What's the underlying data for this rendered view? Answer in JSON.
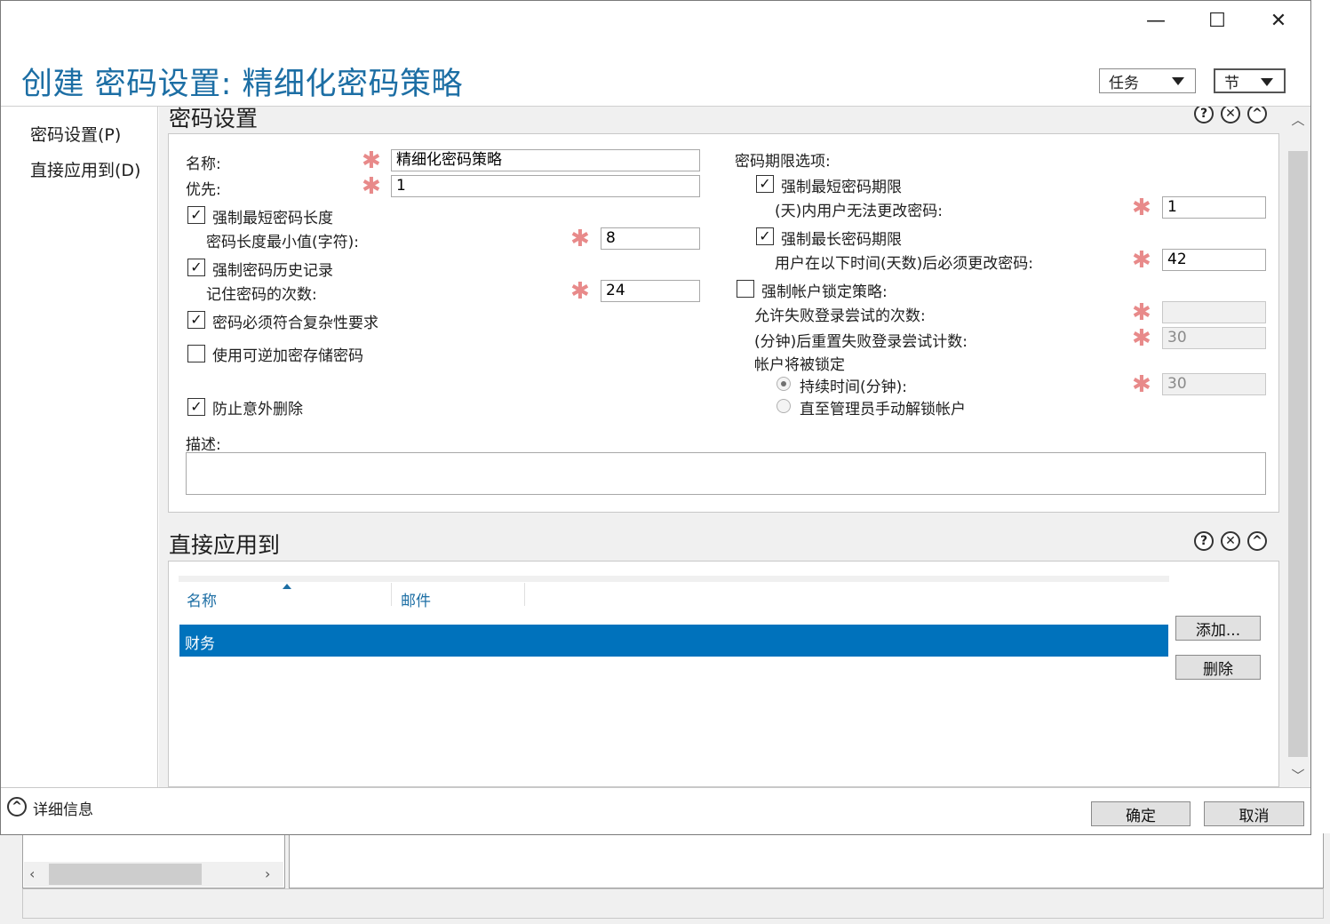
{
  "window": {
    "title": "创建 密码设置: 精细化密码策略",
    "minimize_glyph": "—",
    "maximize_glyph": "☐",
    "close_glyph": "✕"
  },
  "header": {
    "tasks_label": "任务",
    "sections_label": "节"
  },
  "nav": {
    "items": [
      {
        "label": "密码设置(P)"
      },
      {
        "label": "直接应用到(D)"
      }
    ]
  },
  "password_settings": {
    "title": "密码设置",
    "name_label": "名称:",
    "name_value": "精细化密码策略",
    "precedence_label": "优先:",
    "precedence_value": "1",
    "enforce_min_length_label": "强制最短密码长度",
    "min_length_label": "密码长度最小值(字符):",
    "min_length_value": "8",
    "enforce_history_label": "强制密码历史记录",
    "history_count_label": "记住密码的次数:",
    "history_count_value": "24",
    "complexity_label": "密码必须符合复杂性要求",
    "reversible_label": "使用可逆加密存储密码",
    "protect_label": "防止意外删除",
    "description_label": "描述:",
    "description_value": "",
    "age_options_label": "密码期限选项:",
    "enforce_min_age_label": "强制最短密码期限",
    "min_age_label": "(天)内用户无法更改密码:",
    "min_age_value": "1",
    "enforce_max_age_label": "强制最长密码期限",
    "max_age_label": "用户在以下时间(天数)后必须更改密码:",
    "max_age_value": "42",
    "lockout_label": "强制帐户锁定策略:",
    "failed_attempts_label": "允许失败登录尝试的次数:",
    "failed_attempts_value": "",
    "reset_after_label": "(分钟)后重置失败登录尝试计数:",
    "reset_after_value": "30",
    "locked_label": "帐户将被锁定",
    "duration_label": "持续时间(分钟):",
    "duration_value": "30",
    "until_admin_label": "直至管理员手动解锁帐户"
  },
  "apply_to": {
    "title": "直接应用到",
    "columns": [
      "名称",
      "邮件"
    ],
    "rows": [
      {
        "name": "财务",
        "mail": ""
      }
    ],
    "add_label": "添加...",
    "remove_label": "删除"
  },
  "section_icons": {
    "help": "?",
    "close": "✕",
    "collapse": "^"
  },
  "footer": {
    "details_label": "详细信息",
    "ok_label": "确定",
    "cancel_label": "取消"
  },
  "colors": {
    "title": "#1c6ea4",
    "selection": "#0072bc",
    "required_star": "#e88a8a"
  }
}
